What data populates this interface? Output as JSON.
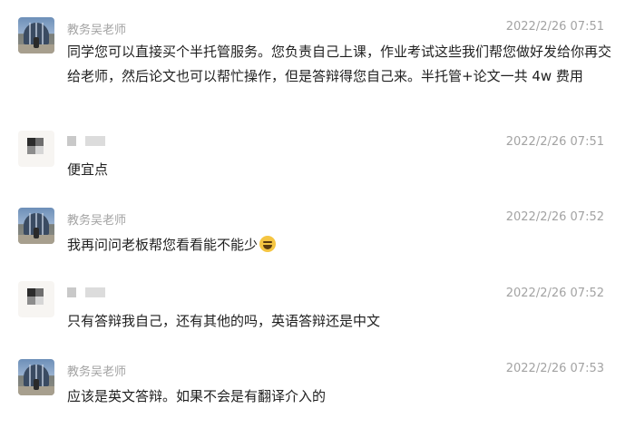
{
  "messages": [
    {
      "sender": "教务吴老师",
      "time": "2022/2/26 07:51",
      "text": "同学您可以直接买个半托管服务。您负责自己上课，作业考试这些我们帮您做好发给你再交给老师，然后论文也可以帮忙操作，但是答辩得您自己来。半托管+论文一共 4w 费用"
    },
    {
      "sender": "",
      "time": "2022/2/26 07:51",
      "text": "便宜点"
    },
    {
      "sender": "教务吴老师",
      "time": "2022/2/26 07:52",
      "text": "我再问问老板帮您看看能不能少"
    },
    {
      "sender": "",
      "time": "2022/2/26 07:52",
      "text": "只有答辩我自己，还有其他的吗，英语答辩还是中文"
    },
    {
      "sender": "教务吴老师",
      "time": "2022/2/26 07:53",
      "text": "应该是英文答辩。如果不会是有翻译介入的"
    }
  ],
  "icons": {
    "emoji": "grinning-sweat-emoji"
  }
}
